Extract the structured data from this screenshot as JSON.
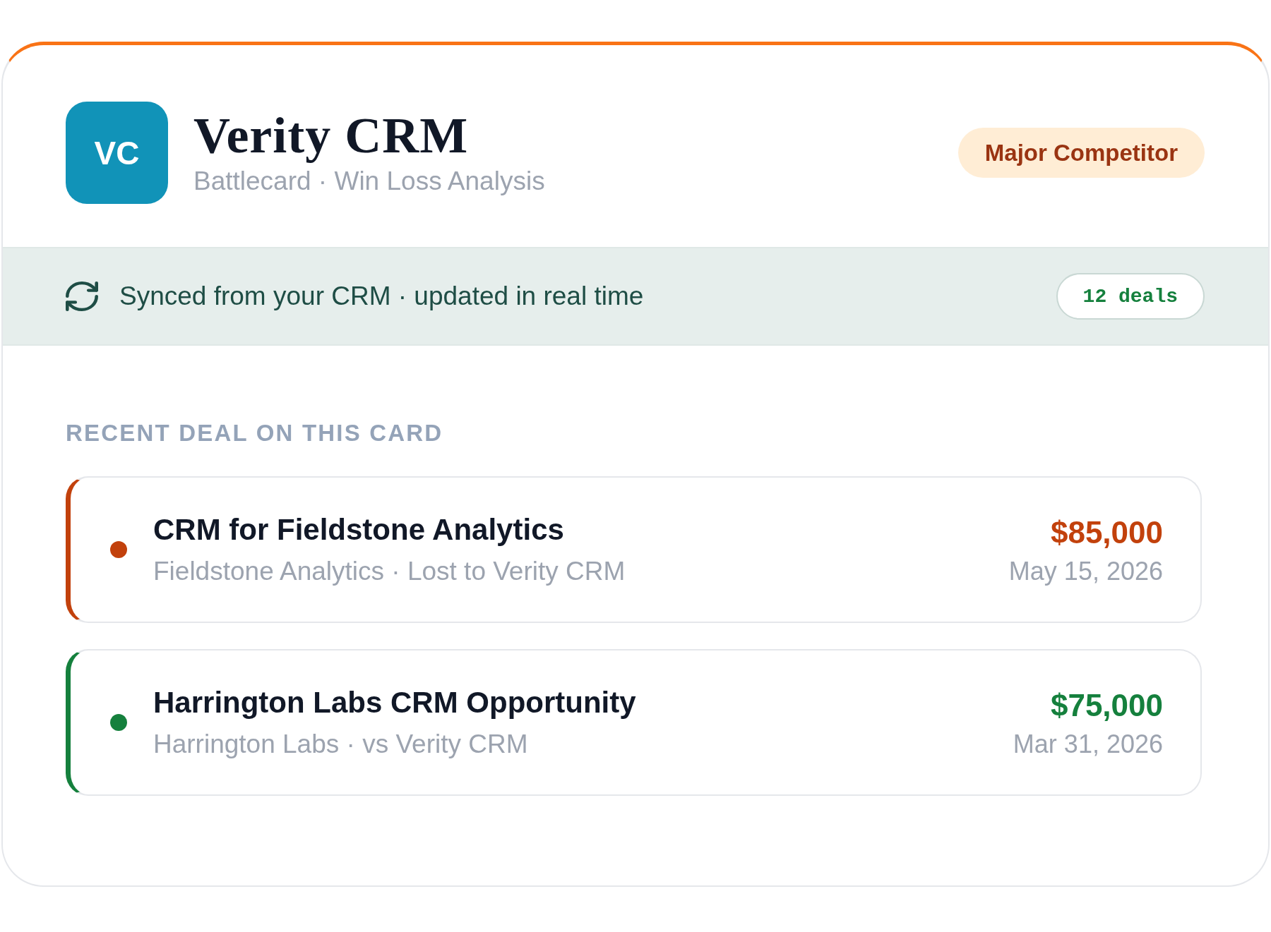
{
  "competitor": {
    "logo_text": "VC",
    "name": "Verity CRM",
    "subtitle": "Battlecard · Win Loss Analysis",
    "badge": "Major Competitor"
  },
  "sync_bar": {
    "text": "Synced from your CRM · updated in real time",
    "deal_count": "12 deals"
  },
  "recent_deals": {
    "heading": "RECENT DEAL ON THIS CARD",
    "deals": [
      {
        "title": "CRM for Fieldstone Analytics",
        "subtitle": "Fieldstone Analytics · Lost to Verity CRM",
        "amount": "$85,000",
        "date": "May 15, 2026",
        "color": "#c2410c"
      },
      {
        "title": "Harrington Labs CRM Opportunity",
        "subtitle": "Harrington Labs · vs Verity CRM",
        "amount": "$75,000",
        "date": "Mar 31, 2026",
        "color": "#15803d"
      }
    ]
  }
}
